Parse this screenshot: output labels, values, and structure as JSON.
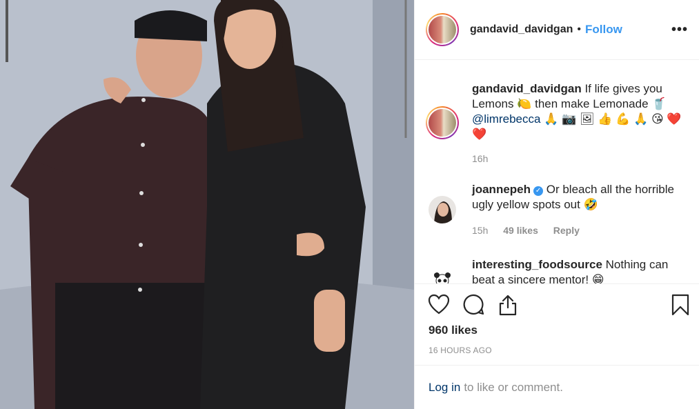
{
  "post": {
    "username": "gandavid_davidgan",
    "follow_label": "Follow",
    "more_label": "•••",
    "dot": "•"
  },
  "comments": [
    {
      "username": "gandavid_davidgan",
      "text_line1": "If life gives you",
      "text_line2": "Lemons 🍋 then make Lemonade 🥤",
      "mention": "@limrebecca",
      "emojis": "🙏 📷 🖼 👍 💪 🙏 😘 ❤️",
      "emoji_line2": "❤️",
      "time": "16h"
    },
    {
      "username": "joannepeh",
      "text": "Or bleach all the horrible ugly yellow spots out 🤣",
      "time": "15h",
      "likes": "49 likes",
      "reply_label": "Reply"
    },
    {
      "username": "interesting_foodsource",
      "text": "Nothing can beat a sincere mentor! 😁"
    }
  ],
  "actions": {
    "like_icon": "heart-icon",
    "comment_icon": "comment-icon",
    "share_icon": "share-icon",
    "save_icon": "bookmark-icon"
  },
  "likes_count": "960 likes",
  "time_ago": "16 HOURS AGO",
  "login": {
    "link": "Log in",
    "rest": "to like or comment."
  },
  "colors": {
    "accent": "#3897f0",
    "text": "#262626",
    "muted": "#8e8e8e",
    "link": "#003569"
  }
}
